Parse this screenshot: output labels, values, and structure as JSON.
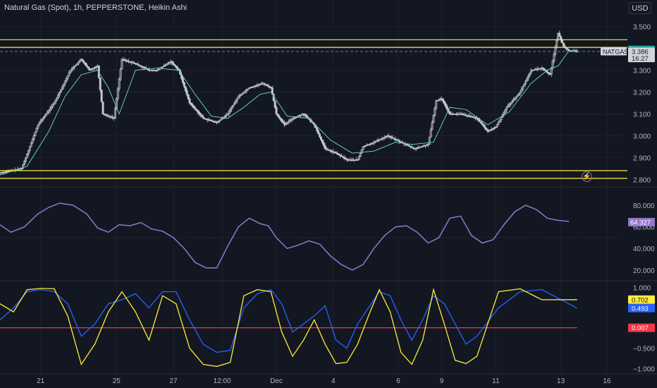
{
  "header": {
    "title": "Natural Gas (Spot), 1h, PEPPERSTONE, Heikin Ashi",
    "currency_button": "USD"
  },
  "icons": {
    "alert": "lightning-bolt-icon"
  },
  "colors": {
    "background": "#131722",
    "grid": "#1e222d",
    "candle": "#c7cad4",
    "ma_line": "#66c6c2",
    "level_line": "#ffeb3b",
    "rsi_line": "#9575cd",
    "stoch_fast": "#ffeb3b",
    "stoch_slow": "#2962ff",
    "zero_line": "#f23645",
    "axis_text": "#b2b5be"
  },
  "price_badges": [
    {
      "text": "3.3948",
      "bg": "#26a69a",
      "fg": "#131722",
      "value": 3.3948
    },
    {
      "text": "3.386",
      "bg": "#d1d4dc",
      "fg": "#131722",
      "value": 3.386
    },
    {
      "text": "16:27",
      "bg": "#d1d4dc",
      "fg": "#131722",
      "value": 3.355
    }
  ],
  "symbol_tag": "NATGAS",
  "x_axis_ticks": [
    {
      "label": "21",
      "index": 15
    },
    {
      "label": "25",
      "index": 43
    },
    {
      "label": "27",
      "index": 64
    },
    {
      "label": "12:00",
      "index": 82
    },
    {
      "label": "Dec",
      "index": 102
    },
    {
      "label": "4",
      "index": 123
    },
    {
      "label": "6",
      "index": 147
    },
    {
      "label": "9",
      "index": 163
    },
    {
      "label": "11",
      "index": 183
    },
    {
      "label": "13",
      "index": 207
    },
    {
      "label": "16",
      "index": 224
    }
  ],
  "chart_data": [
    {
      "type": "line",
      "panel": "price",
      "candle_style": "Heikin Ashi",
      "y_ticks": [
        "3.500",
        "3.400",
        "3.300",
        "3.200",
        "3.100",
        "3.000",
        "2.900",
        "2.800"
      ],
      "ylim": [
        2.775,
        3.525
      ],
      "horizontal_levels": [
        3.44,
        3.405,
        2.84,
        2.805
      ],
      "dashed_level": 3.386,
      "close_x_index": [
        0,
        8,
        14,
        20,
        26,
        30,
        33,
        36,
        38,
        42,
        45,
        50,
        55,
        58,
        63,
        66,
        70,
        75,
        80,
        84,
        88,
        92,
        97,
        100,
        102,
        105,
        108,
        112,
        116,
        120,
        124,
        128,
        132,
        134,
        138,
        143,
        148,
        153,
        158,
        161,
        163,
        166,
        170,
        176,
        180,
        183,
        187,
        192,
        196,
        200,
        203,
        206,
        208,
        210,
        213
      ],
      "close": [
        2.83,
        2.85,
        3.05,
        3.15,
        3.3,
        3.35,
        3.3,
        3.32,
        3.1,
        3.08,
        3.35,
        3.33,
        3.3,
        3.3,
        3.34,
        3.3,
        3.15,
        3.08,
        3.06,
        3.1,
        3.18,
        3.22,
        3.24,
        3.22,
        3.1,
        3.05,
        3.08,
        3.1,
        3.05,
        2.94,
        2.92,
        2.89,
        2.89,
        2.95,
        2.97,
        3.0,
        2.97,
        2.94,
        2.96,
        3.16,
        3.17,
        3.1,
        3.1,
        3.08,
        3.02,
        3.04,
        3.13,
        3.2,
        3.3,
        3.31,
        3.28,
        3.47,
        3.41,
        3.39,
        3.386
      ],
      "ma_x_index": [
        0,
        10,
        18,
        24,
        30,
        36,
        40,
        44,
        50,
        58,
        66,
        72,
        78,
        84,
        90,
        96,
        100,
        106,
        114,
        122,
        130,
        138,
        146,
        152,
        160,
        166,
        172,
        180,
        188,
        196,
        202,
        206,
        210,
        213
      ],
      "ma": [
        2.82,
        2.86,
        3.02,
        3.18,
        3.28,
        3.3,
        3.22,
        3.1,
        3.3,
        3.31,
        3.3,
        3.19,
        3.09,
        3.08,
        3.13,
        3.19,
        3.2,
        3.09,
        3.08,
        2.98,
        2.92,
        2.93,
        2.97,
        2.96,
        2.97,
        3.13,
        3.12,
        3.05,
        3.11,
        3.24,
        3.3,
        3.32,
        3.39,
        3.39
      ]
    },
    {
      "type": "line",
      "panel": "rsi",
      "series": [
        {
          "name": "",
          "values": [
            62,
            55,
            60,
            72,
            78,
            82,
            80,
            72,
            59,
            55,
            62,
            61,
            64,
            58,
            56,
            50,
            40,
            27,
            22,
            22,
            42,
            60,
            68,
            63,
            61,
            50,
            40,
            43,
            47,
            44,
            33,
            25,
            20,
            25,
            40,
            52,
            60,
            61,
            55,
            45,
            50,
            68,
            70,
            52,
            45,
            48,
            62,
            74,
            80,
            76,
            68,
            66,
            65
          ]
        }
      ],
      "x_index": [
        0,
        4,
        9,
        14,
        18,
        22,
        27,
        32,
        36,
        40,
        44,
        48,
        52,
        56,
        60,
        64,
        68,
        72,
        76,
        80,
        84,
        88,
        92,
        96,
        99,
        102,
        106,
        110,
        114,
        118,
        122,
        126,
        130,
        134,
        138,
        142,
        146,
        150,
        154,
        158,
        162,
        166,
        170,
        174,
        178,
        182,
        186,
        190,
        194,
        198,
        202,
        206,
        210
      ],
      "y_ticks": [
        "80.000",
        "60.000",
        "40.000",
        "20.000"
      ],
      "ylim": [
        12,
        95
      ],
      "latest_label": "64.327",
      "latest_value": 64.327,
      "latest_color": "#9575cd"
    },
    {
      "type": "line",
      "panel": "stochastic",
      "series": [
        {
          "name": "",
          "color": "#ffeb3b",
          "values": [
            0.6,
            0.4,
            0.95,
            0.98,
            0.97,
            0.3,
            -0.9,
            -0.4,
            0.4,
            0.9,
            0.4,
            -0.3,
            0.8,
            0.6,
            -0.5,
            -0.9,
            -0.95,
            -0.85,
            0.8,
            0.95,
            0.9,
            -0.1,
            -0.7,
            -0.3,
            0.2,
            -0.4,
            -0.88,
            -0.85,
            -0.4,
            0.3,
            0.95,
            0.4,
            -0.6,
            -0.9,
            -0.3,
            0.95,
            0.1,
            -0.8,
            -0.88,
            -0.7,
            0.9,
            0.97,
            0.7,
            0.702
          ]
        },
        {
          "name": "",
          "color": "#2962ff",
          "values": [
            0.2,
            0.5,
            0.9,
            0.95,
            0.9,
            0.6,
            -0.2,
            0.1,
            0.6,
            0.7,
            0.85,
            0.5,
            0.9,
            0.9,
            0.2,
            -0.4,
            -0.6,
            -0.55,
            0.5,
            0.85,
            0.95,
            0.6,
            -0.1,
            0.1,
            0.3,
            0.55,
            -0.3,
            -0.5,
            0.1,
            0.5,
            0.9,
            0.8,
            0.2,
            -0.3,
            0.2,
            0.8,
            0.6,
            0.1,
            -0.4,
            -0.2,
            0.5,
            0.9,
            0.95,
            0.493
          ]
        }
      ],
      "x_index": [
        0,
        5,
        10,
        15,
        20,
        25,
        30,
        35,
        40,
        45,
        50,
        55,
        60,
        65,
        70,
        75,
        80,
        85,
        90,
        95,
        100,
        104,
        108,
        112,
        116,
        120,
        124,
        128,
        132,
        136,
        140,
        144,
        148,
        152,
        156,
        160,
        164,
        168,
        172,
        176,
        184,
        192,
        200,
        213
      ],
      "zero_line": 0.007,
      "y_ticks": [
        "1.000",
        "0.500",
        "0.000",
        "−0.500",
        "−1.000"
      ],
      "ylim": [
        -1.1,
        1.1
      ],
      "latest_labels": [
        {
          "text": "0.702",
          "value": 0.702,
          "bg": "#ffeb3b",
          "fg": "#131722"
        },
        {
          "text": "0.493",
          "value": 0.493,
          "bg": "#2962ff",
          "fg": "#ffffff"
        },
        {
          "text": "0.007",
          "value": 0.007,
          "bg": "#f23645",
          "fg": "#ffffff"
        }
      ]
    }
  ]
}
